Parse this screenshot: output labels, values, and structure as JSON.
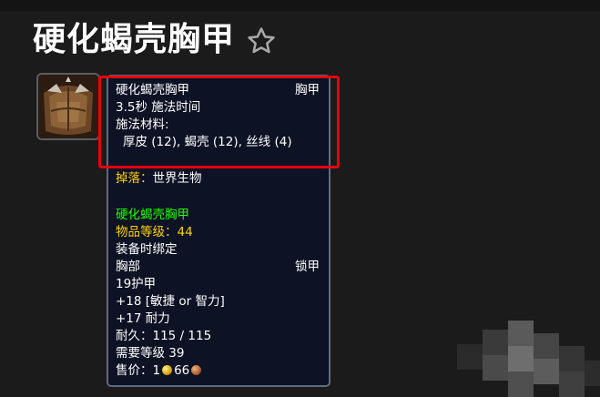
{
  "page": {
    "title": "硬化蝎壳胸甲"
  },
  "tooltip": {
    "recipe": {
      "name": "硬化蝎壳胸甲",
      "slot": "胸甲",
      "cast_time": "3.5秒 施法时间",
      "materials_label": "施法材料:",
      "materials": "厚皮 (12), 蝎壳 (12), 丝线 (4)"
    },
    "drop_label": "掉落：",
    "drop_source": "世界生物",
    "item": {
      "name": "硬化蝎壳胸甲",
      "ilvl_label": "物品等级：",
      "ilvl": "44",
      "bind": "装备时绑定",
      "slot": "胸部",
      "armor_type": "锁甲",
      "armor": "19护甲",
      "stat1": "+18 [敏捷 or 智力]",
      "stat2": "+17 耐力",
      "durability": "耐久：115 / 115",
      "req_level": "需要等级 39",
      "sell_label": "售价：",
      "sell_gold": "1",
      "sell_copper": "66"
    }
  },
  "colors": {
    "quality_green": "#1eff00",
    "label_gold": "#ffd100",
    "highlight_red": "#e5000f",
    "tooltip_bg": "#0d1224"
  },
  "icons": [
    "star-icon",
    "item-icon",
    "gold-coin-icon",
    "copper-coin-icon"
  ]
}
